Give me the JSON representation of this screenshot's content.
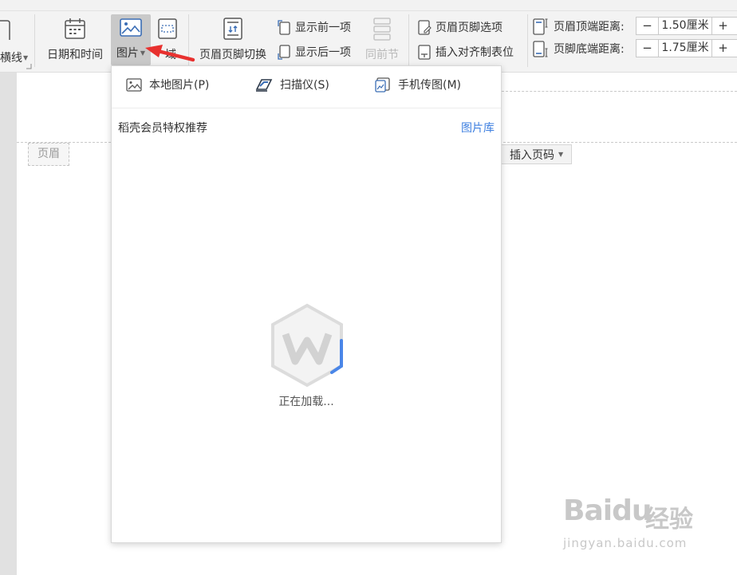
{
  "ribbon": {
    "horizontal_line_label": "横线",
    "datetime_label": "日期和时间",
    "picture_label": "图片",
    "field_label": "域",
    "header_footer_switch_label": "页眉页脚切换",
    "show_prev_label": "显示前一项",
    "show_next_label": "显示后一项",
    "same_as_prev_label": "同前节",
    "header_footer_options_label": "页眉页脚选项",
    "insert_align_tab_label": "插入对齐制表位",
    "header_top_label": "页眉顶端距离:",
    "header_top_value": "1.50厘米",
    "footer_bottom_label": "页脚底端距离:",
    "footer_bottom_value": "1.75厘米",
    "minus": "−",
    "plus": "+"
  },
  "document": {
    "header_tag": "页眉",
    "insert_page_number_label": "插入页码"
  },
  "picture_menu": {
    "items": [
      {
        "label": "本地图片(P)",
        "icon": "image-icon"
      },
      {
        "label": "扫描仪(S)",
        "icon": "scanner-icon"
      },
      {
        "label": "手机传图(M)",
        "icon": "phone-image-icon"
      }
    ],
    "section_title": "稻壳会员特权推荐",
    "gallery_link": "图片库",
    "loading_text": "正在加载..."
  },
  "watermark": {
    "logo_text": "Baidu",
    "logo_cn": "经验",
    "url": "jingyan.baidu.com"
  },
  "colors": {
    "accent_link": "#3d7fe0",
    "annotation_arrow": "#e8312f",
    "loader_arc": "#4a86e8"
  }
}
